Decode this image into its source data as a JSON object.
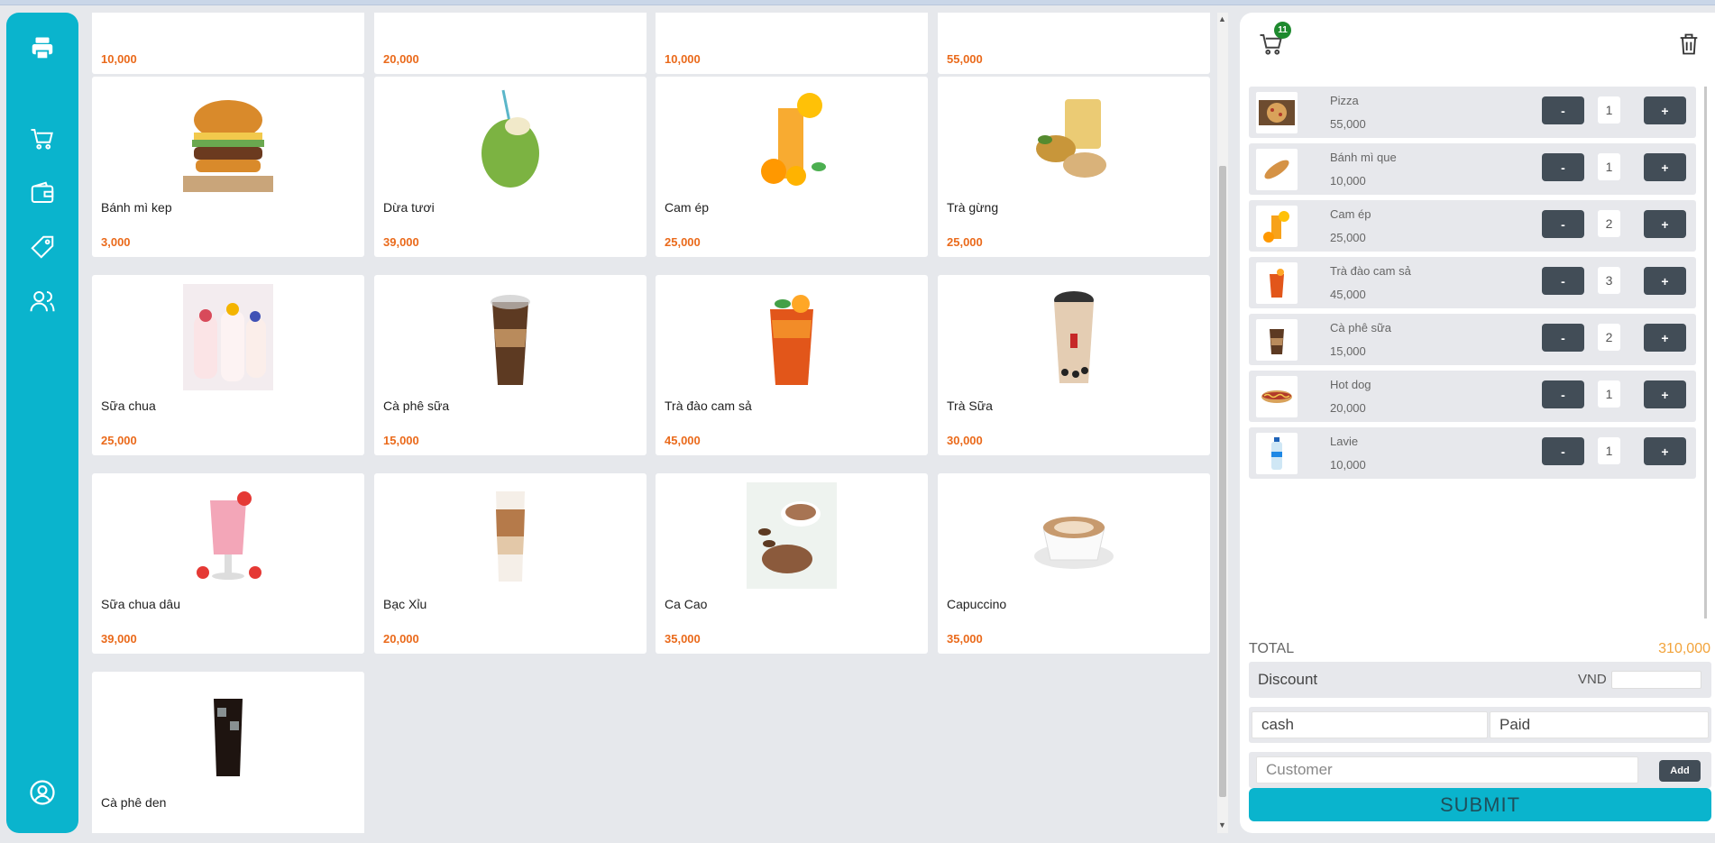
{
  "colors": {
    "accent": "#0ab4cd",
    "price": "#ea6a1b",
    "total": "#f2a33a",
    "button_dark": "#424d57",
    "badge": "#1e8a2e"
  },
  "sidebar": {
    "icons": [
      "printer-icon",
      "cart-icon",
      "wallet-icon",
      "tag-icon",
      "users-icon",
      "user-circle-icon"
    ]
  },
  "products": [
    {
      "name": "",
      "price": "10,000",
      "partial": true
    },
    {
      "name": "",
      "price": "20,000",
      "partial": true
    },
    {
      "name": "",
      "price": "10,000",
      "partial": true
    },
    {
      "name": "",
      "price": "55,000",
      "partial": true
    },
    {
      "name": "Bánh mì kep",
      "price": "3,000"
    },
    {
      "name": "Dừa tươi",
      "price": "39,000"
    },
    {
      "name": "Cam ép",
      "price": "25,000"
    },
    {
      "name": "Trà gừng",
      "price": "25,000"
    },
    {
      "name": "Sữa chua",
      "price": "25,000"
    },
    {
      "name": "Cà phê sữa",
      "price": "15,000"
    },
    {
      "name": "Trà đào cam sả",
      "price": "45,000"
    },
    {
      "name": "Trà Sữa",
      "price": "30,000"
    },
    {
      "name": "Sữa chua dâu",
      "price": "39,000"
    },
    {
      "name": "Bạc Xỉu",
      "price": "20,000"
    },
    {
      "name": "Ca Cao",
      "price": "35,000"
    },
    {
      "name": "Capuccino",
      "price": "35,000"
    },
    {
      "name": "Cà phê den",
      "price": ""
    }
  ],
  "cart": {
    "count": "11",
    "items": [
      {
        "name": "Pizza",
        "price": "55,000",
        "qty": "1"
      },
      {
        "name": "Bánh mì que",
        "price": "10,000",
        "qty": "1"
      },
      {
        "name": "Cam ép",
        "price": "25,000",
        "qty": "2"
      },
      {
        "name": "Trà đào cam sả",
        "price": "45,000",
        "qty": "3"
      },
      {
        "name": "Cà phê sữa",
        "price": "15,000",
        "qty": "2"
      },
      {
        "name": "Hot dog",
        "price": "20,000",
        "qty": "1"
      },
      {
        "name": "Lavie",
        "price": "10,000",
        "qty": "1"
      }
    ],
    "minus_label": "-",
    "plus_label": "+",
    "total_label": "TOTAL",
    "total_value": "310,000",
    "discount_label": "Discount",
    "currency": "VND",
    "discount_value": "",
    "payment_method": "cash",
    "payment_status": "Paid",
    "customer_placeholder": "Customer",
    "add_label": "Add",
    "submit_label": "SUBMIT"
  }
}
